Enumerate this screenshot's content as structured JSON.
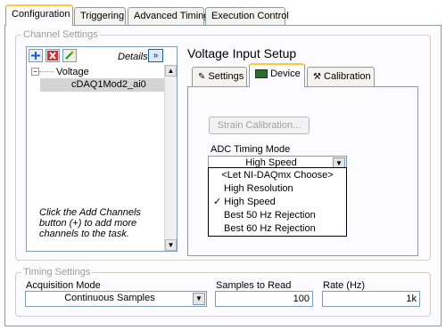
{
  "tabs": [
    "Configuration",
    "Triggering",
    "Advanced Timing",
    "Execution Control"
  ],
  "channel_settings": {
    "title": "Channel Settings",
    "details_label": "Details",
    "tree": {
      "group": "Voltage",
      "channel": "cDAQ1Mod2_ai0"
    },
    "help_text": "Click the Add Channels button (+) to add more channels to the task."
  },
  "voltage_setup": {
    "title": "Voltage Input Setup",
    "tabs": [
      "Settings",
      "Device",
      "Calibration"
    ],
    "strain_button": "Strain Calibration...",
    "adc_label": "ADC Timing Mode",
    "adc_value": "High Speed",
    "options": [
      "<Let NI-DAQmx Choose>",
      "High Resolution",
      "High Speed",
      "Best 50 Hz Rejection",
      "Best 60 Hz Rejection"
    ],
    "checkmark": "✓"
  },
  "timing": {
    "title": "Timing Settings",
    "acq_label": "Acquisition Mode",
    "acq_value": "Continuous Samples",
    "samples_label": "Samples to Read",
    "samples_value": "100",
    "rate_label": "Rate (Hz)",
    "rate_value": "1k"
  }
}
